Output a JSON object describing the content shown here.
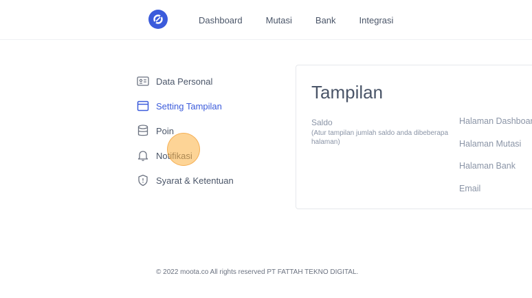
{
  "nav": {
    "items": [
      "Dashboard",
      "Mutasi",
      "Bank",
      "Integrasi"
    ]
  },
  "sidebar": {
    "items": [
      {
        "label": "Data Personal",
        "icon": "id-card-icon"
      },
      {
        "label": "Setting Tampilan",
        "icon": "browser-window-icon"
      },
      {
        "label": "Poin",
        "icon": "database-icon"
      },
      {
        "label": "Notifikasi",
        "icon": "bell-icon"
      },
      {
        "label": "Syarat & Ketentuan",
        "icon": "shield-icon"
      }
    ]
  },
  "content": {
    "title": "Tampilan",
    "saldo_label": "Saldo",
    "saldo_desc": "(Atur tampilan jumlah saldo anda dibeberapa halaman)",
    "options": [
      "Halaman Dashboard",
      "Halaman Mutasi",
      "Halaman Bank",
      "Email"
    ]
  },
  "footer": {
    "text": "© 2022 moota.co All rights reserved PT FATTAH TEKNO DIGITAL."
  },
  "colors": {
    "accent": "#3b5bdb",
    "text": "#4a5568",
    "muted": "#8a94a6",
    "click_marker": "#fbb040"
  }
}
